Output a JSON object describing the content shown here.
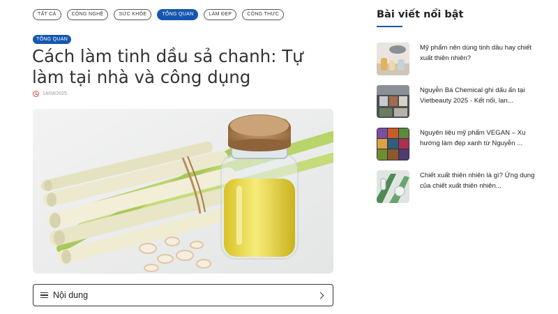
{
  "categories": [
    {
      "label": "TẤT CẢ",
      "active": false
    },
    {
      "label": "CÔNG NGHỆ",
      "active": false
    },
    {
      "label": "SỨC KHỎE",
      "active": false
    },
    {
      "label": "TỔNG QUAN",
      "active": true
    },
    {
      "label": "LÀM ĐẸP",
      "active": false
    },
    {
      "label": "CÔNG THỨC",
      "active": false
    }
  ],
  "article": {
    "badge": "TỔNG QUAN",
    "title": "Cách làm tinh dầu sả chanh: Tự làm tại nhà và công dụng",
    "date": "14/04/2025",
    "clock_icon": "clock-icon"
  },
  "toc": {
    "label": "Nội dung",
    "menu_icon": "hamburger-icon",
    "chevron_icon": "chevron-right-icon"
  },
  "sidebar": {
    "title": "Bài viết nổi bật",
    "items": [
      {
        "text": "Mỹ phẩm nên dùng tinh dầu hay chiết xuất thiên nhiên?"
      },
      {
        "text": "Nguyễn Bá Chemical ghi dấu ấn tại Vietbeauty 2025 - Kết nối, lan..."
      },
      {
        "text": "Nguyên liệu mỹ phẩm VEGAN – Xu hướng làm đẹp xanh từ Nguyễn ..."
      },
      {
        "text": "Chiết xuất thiên nhiên là gì? Ứng dụng của chiết xuất thiên nhiên..."
      }
    ]
  },
  "colors": {
    "accent": "#1557b0",
    "date_icon": "#e0443c"
  }
}
